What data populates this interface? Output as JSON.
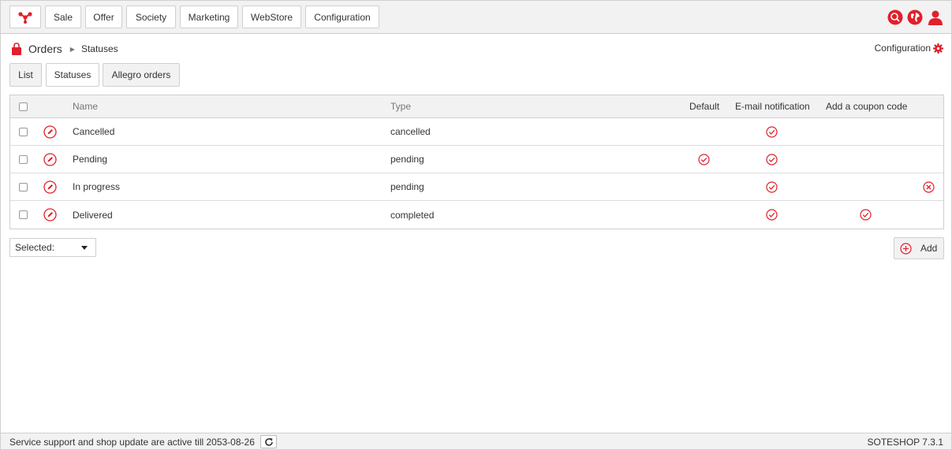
{
  "topnav": {
    "items": [
      {
        "label": "Sale"
      },
      {
        "label": "Offer"
      },
      {
        "label": "Society"
      },
      {
        "label": "Marketing"
      },
      {
        "label": "WebStore"
      },
      {
        "label": "Configuration"
      }
    ],
    "icons": [
      "search-icon",
      "globe-icon",
      "user-icon"
    ]
  },
  "breadcrumb": {
    "title": "Orders",
    "current": "Statuses"
  },
  "config_link": {
    "label": "Configuration"
  },
  "tabs": [
    {
      "label": "List"
    },
    {
      "label": "Statuses"
    },
    {
      "label": "Allegro orders"
    }
  ],
  "table": {
    "headers": {
      "name": "Name",
      "type": "Type",
      "default": "Default",
      "email": "E-mail notification",
      "coupon": "Add a coupon code"
    },
    "rows": [
      {
        "name": "Cancelled",
        "type": "cancelled",
        "default": false,
        "email": true,
        "coupon": false,
        "removable": false
      },
      {
        "name": "Pending",
        "type": "pending",
        "default": true,
        "email": true,
        "coupon": false,
        "removable": false
      },
      {
        "name": "In progress",
        "type": "pending",
        "default": false,
        "email": true,
        "coupon": false,
        "removable": true
      },
      {
        "name": "Delivered",
        "type": "completed",
        "default": false,
        "email": true,
        "coupon": true,
        "removable": false
      }
    ]
  },
  "bulk": {
    "label": "Selected:"
  },
  "add_button": {
    "label": "Add"
  },
  "footer": {
    "text": "Service support and shop update are active till 2053-08-26",
    "version": "SOTESHOP 7.3.1"
  },
  "colors": {
    "accent": "#e0202c",
    "border": "#cfcfcf",
    "panel": "#f2f2f2"
  }
}
